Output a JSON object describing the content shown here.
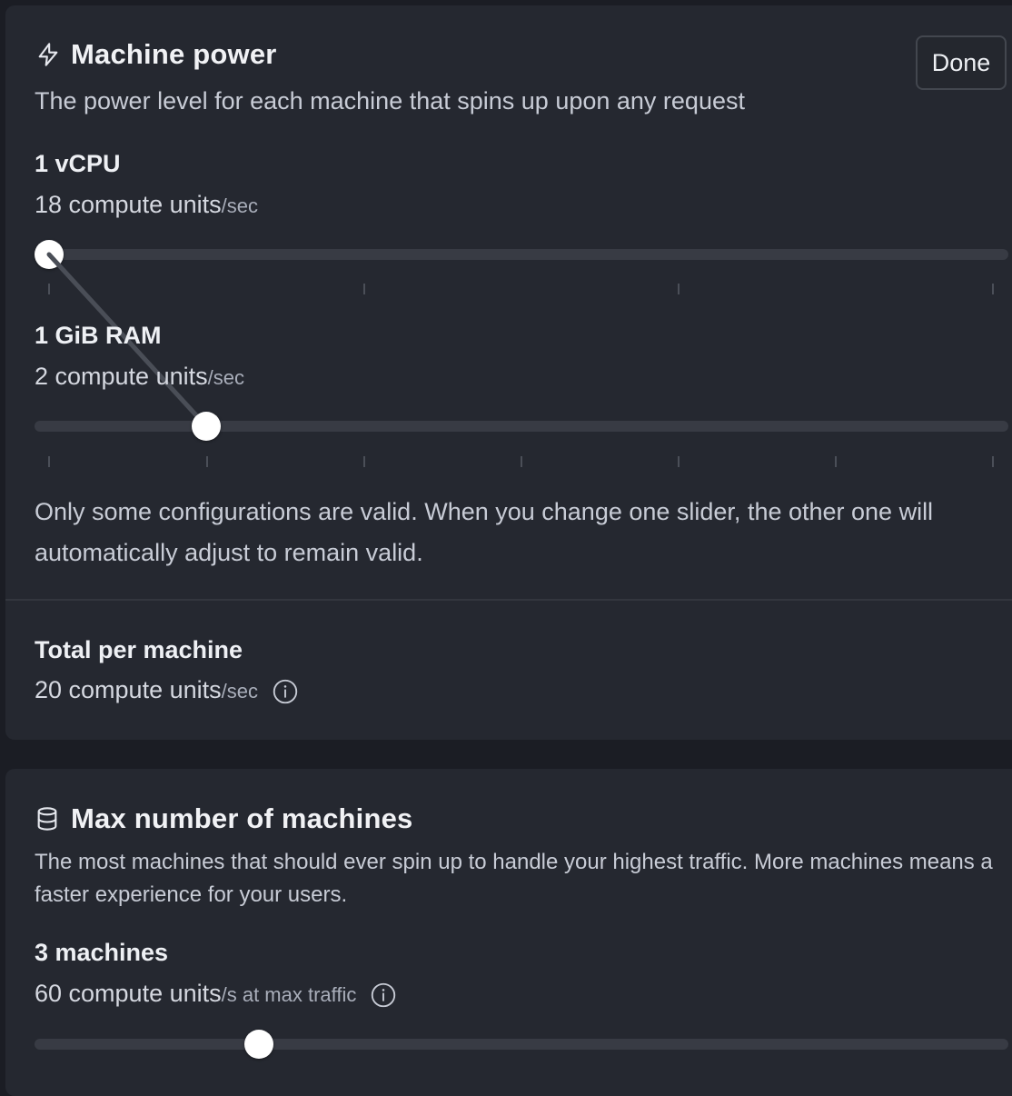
{
  "machine_power": {
    "title": "Machine power",
    "title_icon": "lightning-icon",
    "description": "The power level for each machine that spins up upon any request",
    "done_label": "Done",
    "cpu": {
      "label": "1 vCPU",
      "value": "18 compute units",
      "unit": "/sec",
      "slider_level": 0,
      "tick_count": 4
    },
    "ram": {
      "label": "1 GiB RAM",
      "value": "2 compute units",
      "unit": "/sec",
      "slider_level": 0.1667,
      "tick_count": 7
    },
    "note": "Only some configurations are valid. When you change one slider, the other one will automatically adjust to remain valid.",
    "total": {
      "label": "Total per machine",
      "value": "20 compute units",
      "unit": "/sec",
      "icon": "info-icon"
    }
  },
  "max_machines": {
    "title": "Max number of machines",
    "title_icon": "database-icon",
    "description": "The most machines that should ever spin up to handle your highest traffic. More machines means a faster experience for your users.",
    "count_label": "3 machines",
    "value": "60 compute units",
    "unit": "/s at max traffic",
    "icon": "info-icon",
    "slider_level": 0.23
  },
  "colors": {
    "background": "#1b1d24",
    "card": "#252830",
    "track": "#383b44",
    "thumb": "#ffffff"
  }
}
